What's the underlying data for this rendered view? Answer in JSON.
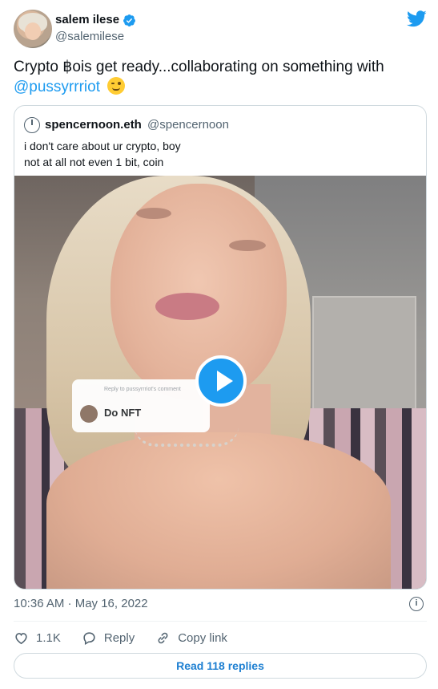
{
  "author": {
    "name": "salem ilese",
    "handle": "@salemilese",
    "verified": true
  },
  "tweet": {
    "text_main": "Crypto ฿ois get ready...collaborating on something with",
    "mention": "@pussyrrriot",
    "emoji": "winking-face"
  },
  "quote": {
    "name": "spencernoon.eth",
    "handle": "@spencernoon",
    "text": "i don't care about ur crypto, boy\nnot at all not even 1 bit, coin",
    "video": {
      "reply_sticker_sub": "Reply to pussyrrriot's comment",
      "reply_sticker_text": "Do NFT"
    }
  },
  "footer": {
    "timestamp": "10:36 AM · May 16, 2022",
    "like_count": "1.1K",
    "reply_label": "Reply",
    "copy_link_label": "Copy link",
    "read_replies_label": "Read 118 replies"
  },
  "colors": {
    "accent": "#1d9bf0",
    "text": "#0f1419",
    "muted": "#536471"
  }
}
